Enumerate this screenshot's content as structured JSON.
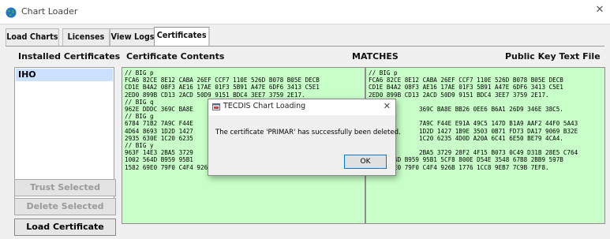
{
  "window": {
    "title": "Chart Loader",
    "close_glyph": "✕",
    "icon": "globe-icon"
  },
  "tabs": [
    {
      "label": "Load Charts",
      "active": false
    },
    {
      "label": "Licenses",
      "active": false
    },
    {
      "label": "View Logs",
      "active": false
    },
    {
      "label": "Certificates",
      "active": true
    }
  ],
  "columns": {
    "installed": "Installed Certificates",
    "contents": "Certificate Contents",
    "matches": "MATCHES",
    "public_key": "Public Key Text File"
  },
  "installed_certificates": [
    "IHO"
  ],
  "buttons": {
    "trust": "Trust Selected",
    "delete": "Delete Selected",
    "load": "Load Certificate"
  },
  "certificate_contents_text": "// BIG p\nFCA6 82CE 8E12 CABA 26EF CCF7 110E 526D B078 B05E DECB\nCD1E B4A2 08F3 AE16 17AE 01F3 5B91 A47E 6DF6 3413 C5E1\n2ED0 899B CD13 2ACD 50D9 9151 BDC4 3EE7 3759 2E17.\n// BIG q\n962E DDDC 369C BA8E\n// BIG g\n6784 71B2 7A9C F44E\n4D64 8693 1D2D 1427\n2935 630E 1C20 6235\n// BIG y\n963F 14E3 2BA5 3729\n1002 564D B959 95B1\n1582 69E0 79F0 C4F4 926B 1776 1CC8 9EB7 7C9B 7EF8.",
  "public_key_text": "// BIG p\nFCA6 82CE 8E12 CABA 26EF CCF7 110E 526D B078 B05E DECB\nCD1E B4A2 08F3 AE16 17AE 01F3 5B91 A47E 6DF6 3413 C5E1\n2ED0 899B CD13 2ACD 50D9 9151 BDC4 3EE7 3759 2E17.\n\n              369C BA8E BB26 0EE6 B6A1 26D9 346E 38C5.\n\n              7A9C F44E E91A 49C5 147D B1A9 AAF2 44F0 5A43\n              1D2D 1427 1B9E 3503 0B71 FD73 DA17 9069 B32E\n              1C20 6235 4D0D A20A 6C41 6E50 BE79 4CA4.\n\n              2BA5 3729 28F2 4F15 B073 0C49 D31B 28E5 C764\n1002 564D B959 95B1 5CF8 800E D54E 3548 67B8 2BB9 597B\n1582 69E0 79F0 C4F4 926B 1776 1CC8 9EB7 7C9B 7EF8.",
  "dialog": {
    "title": "TECDIS Chart Loading",
    "message": "The certificate 'PRIMAR' has successfully been deleted.",
    "ok_label": "OK",
    "close_glyph": "✕"
  },
  "colors": {
    "pane_bg": "#c8ffc8",
    "selected_item": "#cce0ff",
    "ok_border": "#0078d7"
  }
}
